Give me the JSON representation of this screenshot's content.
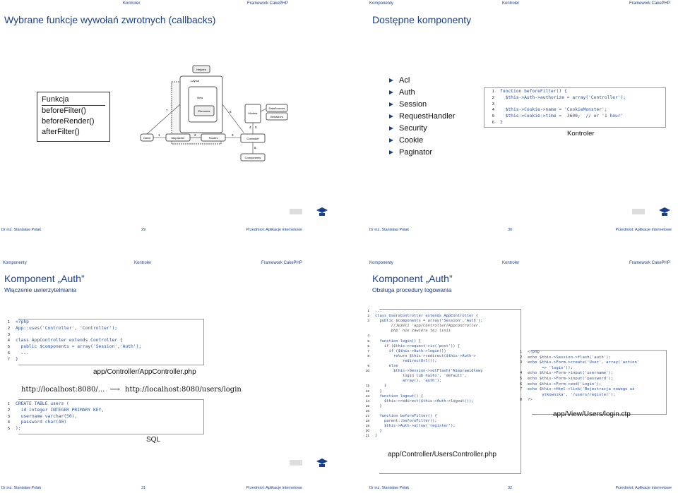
{
  "nav": {
    "a": "Kontroler",
    "b": "Framework CakePHP",
    "c": "Komponenty"
  },
  "footer": {
    "author": "Dr inż. Stanisław Polak",
    "subject": "Przedmiot: Aplikacje internetowe"
  },
  "slide29": {
    "page": "29",
    "title": "Wybrane funkcje wywołań zwrotnych (callbacks)",
    "funcs": [
      "Funkcja",
      "beforeFilter()",
      "beforeRender()",
      "afterFilter()"
    ],
    "diagram": {
      "labels": [
        "Helpers",
        "Layout",
        "View",
        "Elements",
        "Models",
        "DataSources",
        "Behaviors",
        "Client",
        "Dispatcher",
        "Routes",
        "Controller",
        "Components"
      ],
      "numbers": [
        "1",
        "2",
        "3",
        "4",
        "5",
        "6",
        "7",
        "8",
        "5"
      ]
    }
  },
  "slide30": {
    "page": "30",
    "title": "Dostępne komponenty",
    "items": [
      "Acl",
      "Auth",
      "Session",
      "RequestHandler",
      "Security",
      "Cookie",
      "Paginator"
    ],
    "code": [
      "function beforeFilter() {",
      "  $this->Auth->authorize = array('Controller');",
      "",
      "  $this->Cookie->name = 'CookieMonster';",
      "  $this->Cookie->time =  3600;  // or '1 hour'",
      "}"
    ],
    "caption": "Kontroler"
  },
  "slide31": {
    "page": "31",
    "title": "Komponent „Auth”",
    "subtitle": "Włączenie uwierzytelniania",
    "code1": [
      "<?php",
      "App::uses('Controller', 'Controller');",
      "",
      "class AppController extends Controller {",
      "  public $components = array('Session','Auth');",
      "  ...",
      "}"
    ],
    "caption1": "app/Controller/AppController.php",
    "url_from": "http://localhost:8080/...",
    "arrow": "⟶",
    "url_to": "http://localhost:8080/users/login",
    "code2": [
      "CREATE TABLE users (",
      "  id integer INTEGER PRIMARY KEY,",
      "  username varchar(50),",
      "  password char(40)",
      ");"
    ],
    "caption2": "SQL"
  },
  "slide32": {
    "page": "32",
    "title": "Komponent „Auth”",
    "subtitle": "Obsługa procedury logowania",
    "code1": [
      "...",
      "class UsersController extends AppController {",
      "  public $components = array('Session','Auth');",
      "       //Jeżeli 'app/Controller/Appcontroller.",
      "       php' nie zawiera tej linii",
      "",
      "  function login() {",
      "    if ($this->request->is('post')) {",
      "      if ($this->Auth->login())",
      "        return $this->redirect($this->Auth->",
      "            redirectUrl());",
      "      else",
      "        $this->Session->setFlash('Nieprawidłowy",
      "            login lub hasło', 'default',",
      "            array(), 'auth');",
      "    }",
      "  }",
      "  function logout() {",
      "    $this->redirect($this->Auth->logout());",
      "  }",
      "",
      "  function beforeFilter() {",
      "    parent::beforeFilter();",
      "    $this->Auth->allow('register');",
      "  }",
      "}"
    ],
    "code1_numbers": [
      "1",
      "2",
      "3",
      "",
      "",
      "4",
      "5",
      "6",
      "7",
      "8",
      "",
      "9",
      "10",
      "",
      "",
      "11",
      "12",
      "13",
      "14",
      "15",
      "16",
      "17",
      "18",
      "19",
      "20",
      "21"
    ],
    "caption1": "app/Controller/UsersController.php",
    "code2": [
      "<?php",
      "echo $this->Session->flash('auth');",
      "echo $this->Form->create('User', array('action'",
      "      => 'login'));",
      "echo $this->Form->input('username');",
      "echo $this->Form->input('password');",
      "echo $this->Form->end('Login');",
      "echo $this->Html->link('Rejestracja nowego uż",
      "      ytkownika', '/users/register');",
      "?>"
    ],
    "code2_numbers": [
      "1",
      "2",
      "3",
      "",
      "4",
      "5",
      "6",
      "7",
      "",
      "8"
    ],
    "caption2": "app/View/Users/login.ctp"
  }
}
